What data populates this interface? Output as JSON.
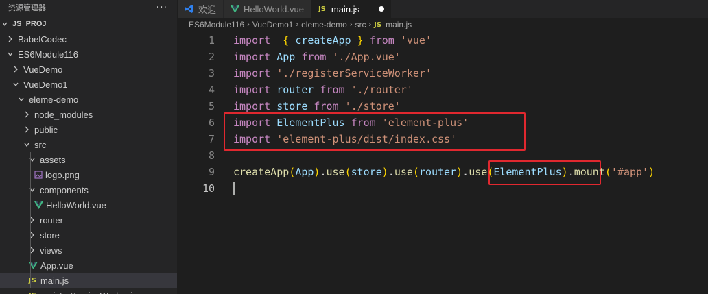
{
  "explorer": {
    "title": "资源管理器",
    "more": "···",
    "tree": [
      {
        "label": "JS_PROJ",
        "indent": 0,
        "kind": "root",
        "expanded": true
      },
      {
        "label": "BabelCodec",
        "indent": 1,
        "kind": "folder",
        "expanded": false
      },
      {
        "label": "ES6Module116",
        "indent": 1,
        "kind": "folder",
        "expanded": true
      },
      {
        "label": "VueDemo",
        "indent": 2,
        "kind": "folder",
        "expanded": false
      },
      {
        "label": "VueDemo1",
        "indent": 2,
        "kind": "folder",
        "expanded": true
      },
      {
        "label": "eleme-demo",
        "indent": 3,
        "kind": "folder",
        "expanded": true
      },
      {
        "label": "node_modules",
        "indent": 4,
        "kind": "folder",
        "expanded": false
      },
      {
        "label": "public",
        "indent": 4,
        "kind": "folder",
        "expanded": false
      },
      {
        "label": "src",
        "indent": 4,
        "kind": "folder",
        "expanded": true
      },
      {
        "label": "assets",
        "indent": 5,
        "kind": "folder",
        "expanded": true
      },
      {
        "label": "logo.png",
        "indent": 6,
        "kind": "image"
      },
      {
        "label": "components",
        "indent": 5,
        "kind": "folder",
        "expanded": true
      },
      {
        "label": "HelloWorld.vue",
        "indent": 6,
        "kind": "vue"
      },
      {
        "label": "router",
        "indent": 5,
        "kind": "folder",
        "expanded": false
      },
      {
        "label": "store",
        "indent": 5,
        "kind": "folder",
        "expanded": false
      },
      {
        "label": "views",
        "indent": 5,
        "kind": "folder",
        "expanded": false
      },
      {
        "label": "App.vue",
        "indent": 5,
        "kind": "vue"
      },
      {
        "label": "main.js",
        "indent": 5,
        "kind": "js",
        "selected": true
      },
      {
        "label": "registerServiceWorker.js",
        "indent": 5,
        "kind": "js"
      }
    ]
  },
  "tabs": [
    {
      "label": "欢迎",
      "icon": "vscode-icon"
    },
    {
      "label": "HelloWorld.vue",
      "icon": "vue-icon"
    },
    {
      "label": "main.js",
      "icon": "js-icon",
      "active": true,
      "dirty": true
    }
  ],
  "js_badge": "JS",
  "breadcrumb": [
    "ES6Module116",
    "VueDemo1",
    "eleme-demo",
    "src",
    "main.js"
  ],
  "code": {
    "current_line": 10,
    "lines": [
      [
        [
          "kw",
          "import"
        ],
        [
          "",
          "  "
        ],
        [
          "br1",
          "{"
        ],
        [
          "",
          " "
        ],
        [
          "id",
          "createApp"
        ],
        [
          "",
          " "
        ],
        [
          "br1",
          "}"
        ],
        [
          "",
          " "
        ],
        [
          "kw",
          "from"
        ],
        [
          "",
          " "
        ],
        [
          "st",
          "'vue'"
        ]
      ],
      [
        [
          "kw",
          "import"
        ],
        [
          "",
          " "
        ],
        [
          "id",
          "App"
        ],
        [
          "",
          " "
        ],
        [
          "kw",
          "from"
        ],
        [
          "",
          " "
        ],
        [
          "st",
          "'./App.vue'"
        ]
      ],
      [
        [
          "kw",
          "import"
        ],
        [
          "",
          " "
        ],
        [
          "st",
          "'./registerServiceWorker'"
        ]
      ],
      [
        [
          "kw",
          "import"
        ],
        [
          "",
          " "
        ],
        [
          "id",
          "router"
        ],
        [
          "",
          " "
        ],
        [
          "kw",
          "from"
        ],
        [
          "",
          " "
        ],
        [
          "st",
          "'./router'"
        ]
      ],
      [
        [
          "kw",
          "import"
        ],
        [
          "",
          " "
        ],
        [
          "id",
          "store"
        ],
        [
          "",
          " "
        ],
        [
          "kw",
          "from"
        ],
        [
          "",
          " "
        ],
        [
          "st",
          "'./store'"
        ]
      ],
      [
        [
          "kw",
          "import"
        ],
        [
          "",
          " "
        ],
        [
          "id",
          "ElementPlus"
        ],
        [
          "",
          " "
        ],
        [
          "kw",
          "from"
        ],
        [
          "",
          " "
        ],
        [
          "st",
          "'element-plus'"
        ]
      ],
      [
        [
          "kw",
          "import"
        ],
        [
          "",
          " "
        ],
        [
          "st",
          "'element-plus/dist/index.css'"
        ]
      ],
      [],
      [
        [
          "fn",
          "createApp"
        ],
        [
          "br1",
          "("
        ],
        [
          "id",
          "App"
        ],
        [
          "br1",
          ")"
        ],
        [
          "",
          "."
        ],
        [
          "fn",
          "use"
        ],
        [
          "br1",
          "("
        ],
        [
          "id",
          "store"
        ],
        [
          "br1",
          ")"
        ],
        [
          "",
          "."
        ],
        [
          "fn",
          "use"
        ],
        [
          "br1",
          "("
        ],
        [
          "id",
          "router"
        ],
        [
          "br1",
          ")"
        ],
        [
          "",
          "."
        ],
        [
          "fn",
          "use"
        ],
        [
          "br1",
          "("
        ],
        [
          "id",
          "ElementPlus"
        ],
        [
          "br1",
          ")"
        ],
        [
          "",
          "."
        ],
        [
          "fn",
          "mount"
        ],
        [
          "br1",
          "("
        ],
        [
          "st",
          "'#app'"
        ],
        [
          "br1",
          ")"
        ]
      ],
      []
    ]
  },
  "colors": {
    "highlight_box": "#e0282f",
    "vue_green": "#41b883",
    "js_yellow": "#cbcb41",
    "vscode_blue": "#2f80ed"
  }
}
